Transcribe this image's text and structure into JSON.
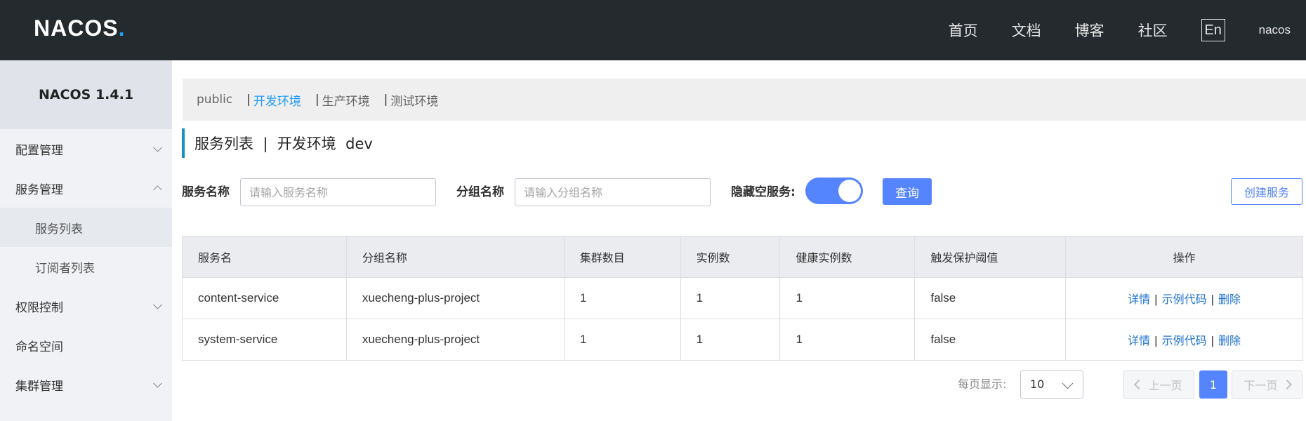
{
  "header": {
    "logo_main": "NACOS",
    "logo_dot": ".",
    "nav": [
      "首页",
      "文档",
      "博客",
      "社区"
    ],
    "lang": "En",
    "user": "nacos"
  },
  "sidebar": {
    "title": "NACOS 1.4.1",
    "items": [
      {
        "label": "配置管理"
      },
      {
        "label": "服务管理"
      },
      {
        "label": "服务列表"
      },
      {
        "label": "订阅者列表"
      },
      {
        "label": "权限控制"
      },
      {
        "label": "命名空间"
      },
      {
        "label": "集群管理"
      }
    ]
  },
  "namespaces": {
    "items": [
      "public",
      "开发环境",
      "生产环境",
      "测试环境"
    ],
    "separator": "|",
    "active_index": 1
  },
  "page": {
    "title": "服务列表  |  开发环境  dev"
  },
  "filters": {
    "service_label": "服务名称",
    "service_placeholder": "请输入服务名称",
    "group_label": "分组名称",
    "group_placeholder": "请输入分组名称",
    "hide_empty_label": "隐藏空服务:",
    "hide_empty_on": true,
    "query_label": "查询",
    "create_label": "创建服务"
  },
  "table": {
    "headers": [
      "服务名",
      "分组名称",
      "集群数目",
      "实例数",
      "健康实例数",
      "触发保护阈值",
      "操作"
    ],
    "rows": [
      [
        "content-service",
        "xuecheng-plus-project",
        "1",
        "1",
        "1",
        "false"
      ],
      [
        "system-service",
        "xuecheng-plus-project",
        "1",
        "1",
        "1",
        "false"
      ]
    ],
    "ops": {
      "detail": "详情",
      "sample": "示例代码",
      "delete": "删除",
      "sep": "|"
    }
  },
  "pager": {
    "size_label": "每页显示:",
    "size_value": "10",
    "prev": "上一页",
    "next": "下一页",
    "current": "1"
  },
  "colors": {
    "header_bg": "#252a2f",
    "accent": "#5584ff",
    "link": "#1e72d0",
    "active_ns": "#209bfa"
  }
}
